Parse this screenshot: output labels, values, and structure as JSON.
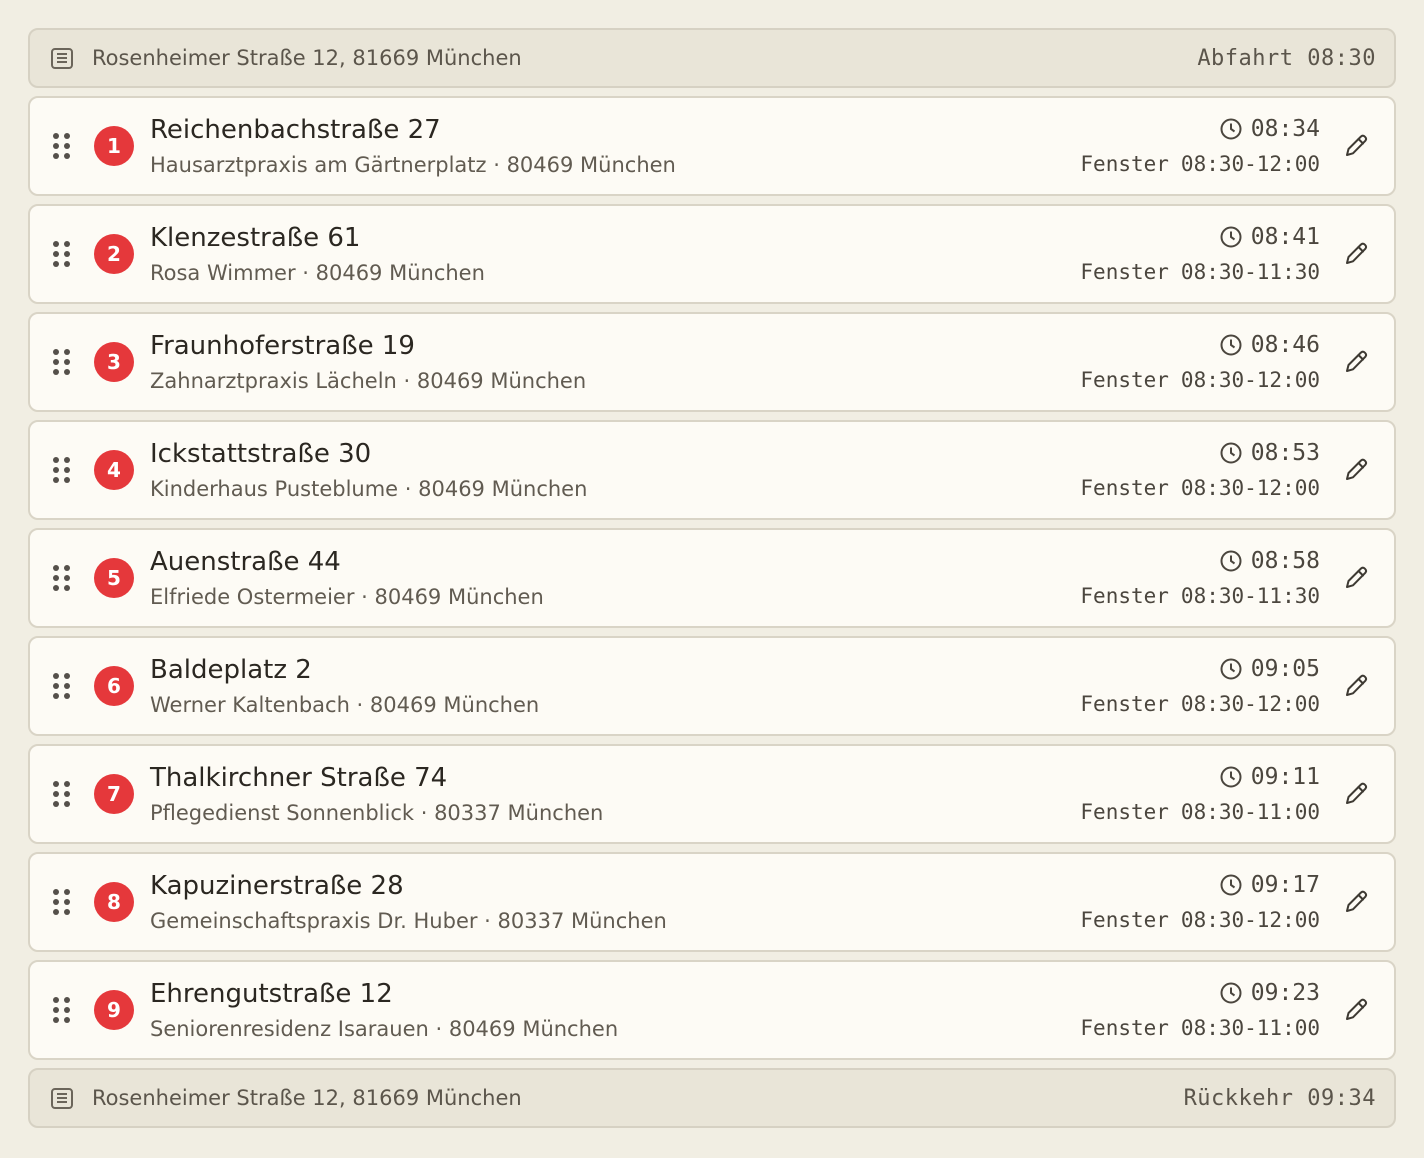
{
  "start": {
    "icon": "building-icon",
    "address": "Rosenheimer Straße 12, 81669 München",
    "time_label": "Abfahrt 08:30"
  },
  "stops": [
    {
      "number": "1",
      "street": "Reichenbachstraße 27",
      "subtitle": "Hausarztpraxis am Gärtnerplatz · 80469 München",
      "eta": "08:34",
      "window_label": "Fenster",
      "window": "08:30-12:00"
    },
    {
      "number": "2",
      "street": "Klenzestraße 61",
      "subtitle": "Rosa Wimmer · 80469 München",
      "eta": "08:41",
      "window_label": "Fenster",
      "window": "08:30-11:30"
    },
    {
      "number": "3",
      "street": "Fraunhoferstraße 19",
      "subtitle": "Zahnarztpraxis Lächeln · 80469 München",
      "eta": "08:46",
      "window_label": "Fenster",
      "window": "08:30-12:00"
    },
    {
      "number": "4",
      "street": "Ickstattstraße 30",
      "subtitle": "Kinderhaus Pusteblume · 80469 München",
      "eta": "08:53",
      "window_label": "Fenster",
      "window": "08:30-12:00"
    },
    {
      "number": "5",
      "street": "Auenstraße 44",
      "subtitle": "Elfriede Ostermeier · 80469 München",
      "eta": "08:58",
      "window_label": "Fenster",
      "window": "08:30-11:30"
    },
    {
      "number": "6",
      "street": "Baldeplatz 2",
      "subtitle": "Werner Kaltenbach · 80469 München",
      "eta": "09:05",
      "window_label": "Fenster",
      "window": "08:30-12:00"
    },
    {
      "number": "7",
      "street": "Thalkirchner Straße 74",
      "subtitle": "Pflegedienst Sonnenblick · 80337 München",
      "eta": "09:11",
      "window_label": "Fenster",
      "window": "08:30-11:00"
    },
    {
      "number": "8",
      "street": "Kapuzinerstraße 28",
      "subtitle": "Gemeinschaftspraxis Dr. Huber · 80337 München",
      "eta": "09:17",
      "window_label": "Fenster",
      "window": "08:30-12:00"
    },
    {
      "number": "9",
      "street": "Ehrengutstraße 12",
      "subtitle": "Seniorenresidenz Isarauen · 80469 München",
      "eta": "09:23",
      "window_label": "Fenster",
      "window": "08:30-11:00"
    }
  ],
  "end": {
    "icon": "building-icon",
    "address": "Rosenheimer Straße 12, 81669 München",
    "time_label": "Rückkehr 09:34"
  },
  "colors": {
    "badge": "#e5383b",
    "background": "#f1eee3",
    "card": "#fdfbf5",
    "depot": "#e9e5d8"
  },
  "icons": {
    "drag": "drag-handle-icon",
    "eta": "clock-icon",
    "edit": "pencil-icon"
  }
}
